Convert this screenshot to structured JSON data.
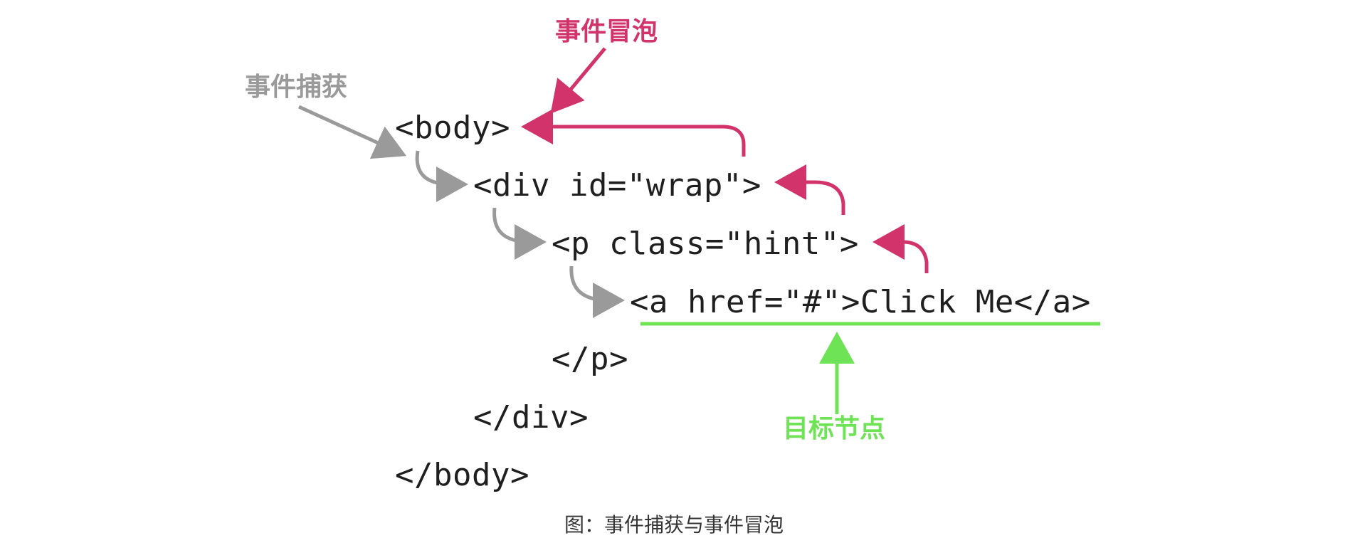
{
  "diagram": {
    "code_lines": [
      "<body>",
      "<div id=\"wrap\">",
      "<p class=\"hint\">",
      "<a href=\"#\">Click Me</a>",
      "</p>",
      "</div>",
      "</body>"
    ],
    "labels": {
      "bubble": "事件冒泡",
      "capture": "事件捕获",
      "target": "目标节点"
    },
    "caption": "图：事件捕获与事件冒泡",
    "colors": {
      "bubble": "#d2336b",
      "capture": "#9a9a9a",
      "target": "#6fe356",
      "code": "#1f1f1f"
    }
  }
}
